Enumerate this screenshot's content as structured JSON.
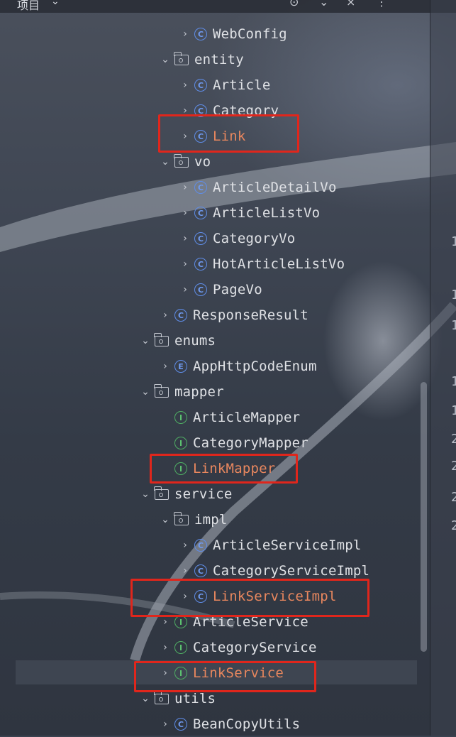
{
  "header": {
    "title": "项目",
    "chevron": "⌄",
    "icons": [
      "target-icon",
      "chevron-down-icon",
      "close-icon",
      "more-icon"
    ]
  },
  "gutter": [
    "1",
    "1",
    "1",
    "1",
    "1",
    "2",
    "2",
    "2",
    "2"
  ],
  "tree": [
    {
      "label": "WebConfig",
      "type": "class",
      "expanded": false
    },
    {
      "label": "entity",
      "type": "package",
      "expanded": true
    },
    {
      "label": "Article",
      "type": "class",
      "expanded": false
    },
    {
      "label": "Category",
      "type": "class",
      "expanded": false
    },
    {
      "label": "Link",
      "type": "class",
      "expanded": false,
      "highlight": true
    },
    {
      "label": "vo",
      "type": "package",
      "expanded": true
    },
    {
      "label": "ArticleDetailVo",
      "type": "class",
      "expanded": false
    },
    {
      "label": "ArticleListVo",
      "type": "class",
      "expanded": false
    },
    {
      "label": "CategoryVo",
      "type": "class",
      "expanded": false
    },
    {
      "label": "HotArticleListVo",
      "type": "class",
      "expanded": false
    },
    {
      "label": "PageVo",
      "type": "class",
      "expanded": false
    },
    {
      "label": "ResponseResult",
      "type": "class",
      "expanded": false
    },
    {
      "label": "enums",
      "type": "package",
      "expanded": true
    },
    {
      "label": "AppHttpCodeEnum",
      "type": "enum",
      "expanded": false
    },
    {
      "label": "mapper",
      "type": "package",
      "expanded": true
    },
    {
      "label": "ArticleMapper",
      "type": "interface"
    },
    {
      "label": "CategoryMapper",
      "type": "interface"
    },
    {
      "label": "LinkMapper",
      "type": "interface",
      "highlight": true
    },
    {
      "label": "service",
      "type": "package",
      "expanded": true
    },
    {
      "label": "impl",
      "type": "package",
      "expanded": true
    },
    {
      "label": "ArticleServiceImpl",
      "type": "class",
      "expanded": false
    },
    {
      "label": "CategoryServiceImpl",
      "type": "class",
      "expanded": false
    },
    {
      "label": "LinkServiceImpl",
      "type": "class",
      "expanded": false,
      "highlight": true
    },
    {
      "label": "ArticleService",
      "type": "interface",
      "expanded": false
    },
    {
      "label": "CategoryService",
      "type": "interface",
      "expanded": false
    },
    {
      "label": "LinkService",
      "type": "interface",
      "expanded": false,
      "highlight": true,
      "selected": true
    },
    {
      "label": "utils",
      "type": "package",
      "expanded": true
    },
    {
      "label": "BeanCopyUtils",
      "type": "class",
      "expanded": false
    }
  ],
  "icon_glyphs": {
    "class": "C",
    "interface": "I",
    "enum": "E"
  },
  "arrow_glyphs": {
    "collapsed": "›",
    "expanded": "⌄"
  },
  "colors": {
    "highlight_text": "#e9875e",
    "annotation_box": "#e0261c",
    "class_icon": "#5f8de8",
    "interface_icon": "#4fae63"
  }
}
